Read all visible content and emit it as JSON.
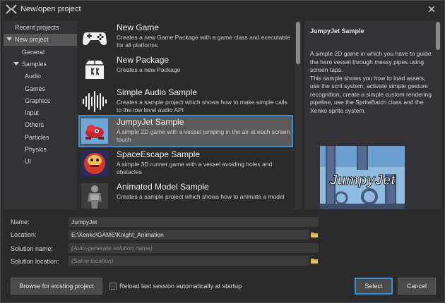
{
  "window": {
    "title": "New/open project"
  },
  "tree": {
    "items": [
      {
        "label": "Recent projects",
        "indent": 0,
        "expanded": false,
        "selected": false
      },
      {
        "label": "New project",
        "indent": 0,
        "expanded": true,
        "selected": true
      },
      {
        "label": "General",
        "indent": 1,
        "expanded": false,
        "selected": false
      },
      {
        "label": "Samples",
        "indent": 1,
        "expanded": true,
        "selected": false
      },
      {
        "label": "Audio",
        "indent": 2,
        "expanded": false,
        "selected": false
      },
      {
        "label": "Games",
        "indent": 2,
        "expanded": false,
        "selected": false
      },
      {
        "label": "Graphics",
        "indent": 2,
        "expanded": false,
        "selected": false
      },
      {
        "label": "Input",
        "indent": 2,
        "expanded": false,
        "selected": false
      },
      {
        "label": "Others",
        "indent": 2,
        "expanded": false,
        "selected": false
      },
      {
        "label": "Particles",
        "indent": 2,
        "expanded": false,
        "selected": false
      },
      {
        "label": "Physics",
        "indent": 2,
        "expanded": false,
        "selected": false
      },
      {
        "label": "UI",
        "indent": 2,
        "expanded": false,
        "selected": false
      }
    ]
  },
  "projects": [
    {
      "title": "New Game",
      "desc": "Creates a new Game Package with a game class and executable for all platforms",
      "icon": "gamepad-icon"
    },
    {
      "title": "New Package",
      "desc": "Creates a new Package",
      "icon": "package-icon"
    },
    {
      "title": "Simple Audio Sample",
      "desc": "Creates a sample project which shows how to make simple calls to the low level audio API",
      "icon": "audio-waveform-icon"
    },
    {
      "title": "JumpyJet Sample",
      "desc": "A simple 2D game with a vessel jumping in the air at each screen touch",
      "icon": "jumpyjet-thumbnail",
      "selected": true
    },
    {
      "title": "SpaceEscape Sample",
      "desc": "A simple 3D runner game with a vessel avoiding holes and obstacles",
      "icon": "spaceescape-thumbnail"
    },
    {
      "title": "Animated Model Sample",
      "desc": "Creates a sample project which shows how to animate a model",
      "icon": "animated-model-thumbnail"
    }
  ],
  "preview": {
    "title": "JumpyJet Sample",
    "desc": "A simple 2D game in which you have to guide the hero vessel through messy pipes using screen taps.\nThis sample shows you how to load assets, use the scrit system, activate simple gesture recognition, create a simple custom rendering pipeline, use the SpriteBatch class and the Xenko sprite system.",
    "logo_text": "JumpyJet"
  },
  "form": {
    "name_label": "Name:",
    "name_value": "JumpyJet",
    "location_label": "Location:",
    "location_value": "E:\\Xenko\\GAME\\Knight_Animation",
    "solution_name_label": "Solution name:",
    "solution_name_placeholder": "(Auto-generate solution name)",
    "solution_location_label": "Solution location:",
    "solution_location_placeholder": "(Same location)"
  },
  "bottom": {
    "browse_label": "Browse for existing project",
    "reload_label": "Reload last session automatically at startup",
    "reload_checked": false,
    "select_label": "Select",
    "cancel_label": "Cancel"
  },
  "colors": {
    "accent": "#3d8fd1",
    "background": "#2b2b2b",
    "panel": "#333337",
    "selection": "#5a5a5c"
  }
}
